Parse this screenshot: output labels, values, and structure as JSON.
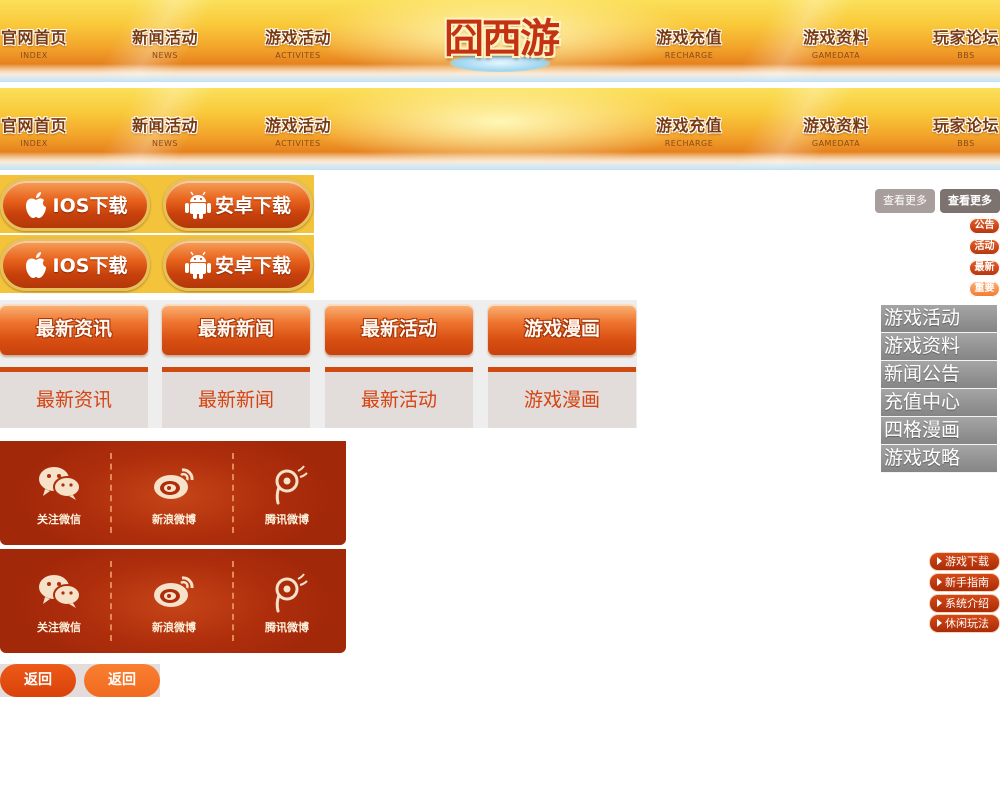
{
  "navbars": [
    {
      "items": [
        {
          "cn": "官网首页",
          "en": "INDEX"
        },
        {
          "cn": "新闻活动",
          "en": "NEWS"
        },
        {
          "cn": "游戏活动",
          "en": "ACTIVITES"
        },
        {
          "cn": "游戏充值",
          "en": "RECHARGE"
        },
        {
          "cn": "游戏资料",
          "en": "GAMEDATA"
        },
        {
          "cn": "玩家论坛",
          "en": "BBS"
        }
      ],
      "logo": "囧西游"
    },
    {
      "items": [
        {
          "cn": "官网首页",
          "en": "INDEX"
        },
        {
          "cn": "新闻活动",
          "en": "NEWS"
        },
        {
          "cn": "游戏活动",
          "en": "ACTIVITES"
        },
        {
          "cn": "游戏充值",
          "en": "RECHARGE"
        },
        {
          "cn": "游戏资料",
          "en": "GAMEDATA"
        },
        {
          "cn": "玩家论坛",
          "en": "BBS"
        }
      ]
    }
  ],
  "downloads": [
    {
      "ios": "IOS下载",
      "android": "安卓下载"
    },
    {
      "ios": "IOS下载",
      "android": "安卓下载"
    }
  ],
  "more_buttons": [
    "查看更多",
    "查看更多"
  ],
  "tags": [
    "公告",
    "活动",
    "最新",
    "重要"
  ],
  "tabs_primary": [
    "最新资讯",
    "最新新闻",
    "最新活动",
    "游戏漫画"
  ],
  "tabs_secondary": [
    "最新资讯",
    "最新新闻",
    "最新活动",
    "游戏漫画"
  ],
  "side_menu": [
    "游戏活动",
    "游戏资料",
    "新闻公告",
    "充值中心",
    "四格漫画",
    "游戏攻略"
  ],
  "social_panels": [
    {
      "items": [
        "关注微信",
        "新浪微博",
        "腾讯微博"
      ]
    },
    {
      "items": [
        "关注微信",
        "新浪微博",
        "腾讯微博"
      ]
    }
  ],
  "guide_links": [
    "游戏下载",
    "新手指南",
    "系统介绍",
    "休闲玩法"
  ],
  "back_buttons": [
    "返回",
    "返回"
  ],
  "colors": {
    "nav_gold": "#f9c93a",
    "nav_orange": "#e6821f",
    "accent_red": "#d04a10",
    "social_red": "#ae2e0c",
    "side_gray": "#959595",
    "back_orange": "#f06a20"
  }
}
